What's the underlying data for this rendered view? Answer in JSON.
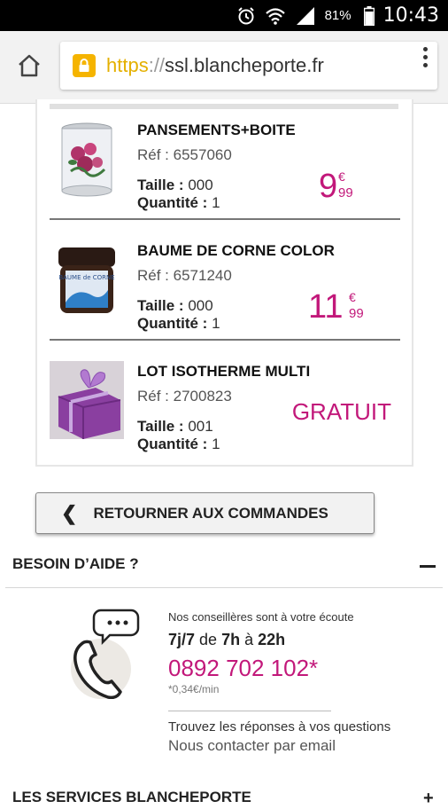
{
  "status_bar": {
    "battery": "81%",
    "time": "10:43"
  },
  "browser": {
    "url_scheme": "https",
    "url_sep": "://",
    "url_host": "ssl.blancheporte.fr"
  },
  "order": {
    "items": [
      {
        "name": "PANSEMENTS+BOITE",
        "ref": "Réf : 6557060",
        "size_label": "Taille :",
        "size_value": " 000",
        "qty_label": "Quantité :",
        "qty_value": " 1",
        "price_int": "9",
        "price_cur": "€",
        "price_dec": "99"
      },
      {
        "name": "BAUME DE CORNE COLOR",
        "ref": "Réf : 6571240",
        "size_label": "Taille :",
        "size_value": " 000",
        "qty_label": "Quantité :",
        "qty_value": " 1",
        "price_int": "11",
        "price_cur": "€",
        "price_dec": "99",
        "jar_text": "BAUME de CORNE"
      },
      {
        "name": "LOT ISOTHERME MULTI",
        "ref": "Réf : 2700823",
        "size_label": "Taille :",
        "size_value": " 001",
        "qty_label": "Quantité :",
        "qty_value": " 1",
        "free_label": "GRATUIT"
      }
    ]
  },
  "back_button": {
    "label": "RETOURNER AUX COMMANDES"
  },
  "help": {
    "title": "BESOIN D’AIDE ?",
    "intro": "Nos conseillères sont à votre écoute",
    "hours_days": "7j/7",
    "hours_from": " de ",
    "hours_start": "7h",
    "hours_to": " à ",
    "hours_end": "22h",
    "phone": "0892 702 102*",
    "cost": "*0,34€/min",
    "faq": "Trouvez les réponses à vos questions",
    "email_link": "Nous contacter par email"
  },
  "services": {
    "title": "LES SERVICES BLANCHEPORTE",
    "toggle": "+"
  },
  "colors": {
    "accent": "#c2187a",
    "lock": "#f5b400"
  }
}
